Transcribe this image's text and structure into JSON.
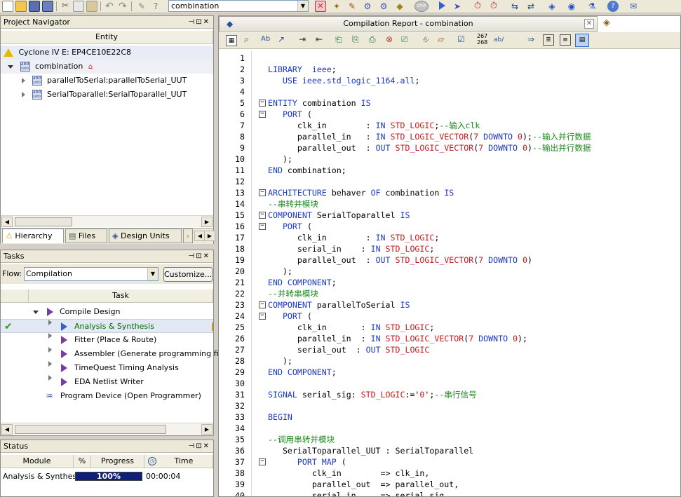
{
  "toolbar": {
    "project_combo": "combination"
  },
  "project_navigator": {
    "title": "Project Navigator",
    "entity_header": "Entity",
    "device": "Cyclone IV E: EP4CE10E22C8",
    "top": "combination",
    "children": [
      "parallelToSerial:parallelToSerial_UUT",
      "SerialToparallel:SerialToparallel_UUT"
    ],
    "tabs": [
      "Hierarchy",
      "Files",
      "Design Units"
    ]
  },
  "tasks": {
    "title": "Tasks",
    "flow_label": "Flow:",
    "flow_value": "Compilation",
    "customize": "Customize...",
    "task_header": "Task",
    "items": [
      {
        "label": "Compile Design"
      },
      {
        "label": "Analysis & Synthesis"
      },
      {
        "label": "Fitter (Place & Route)"
      },
      {
        "label": "Assembler (Generate programming files)"
      },
      {
        "label": "TimeQuest Timing Analysis"
      },
      {
        "label": "EDA Netlist Writer"
      },
      {
        "label": "Program Device (Open Programmer)"
      }
    ]
  },
  "status": {
    "title": "Status",
    "headers": {
      "module": "Module",
      "percent": "%",
      "progress": "Progress",
      "time": "Time"
    },
    "row": {
      "module": "Analysis & Synthesis",
      "progress": "100%",
      "progress_fraction": 1.0,
      "time": "00:00:04"
    }
  },
  "editor": {
    "tab_title": "Compilation Report - combination",
    "tool_numbers": "267\n268",
    "tool_ab": "ab/",
    "lines": [
      {
        "n": "1",
        "t": []
      },
      {
        "n": "2",
        "t": [
          [
            "kw",
            "LIBRARY"
          ],
          [
            "",
            "  "
          ],
          [
            "kw",
            "ieee"
          ],
          [
            "",
            ";"
          ]
        ]
      },
      {
        "n": "3",
        "t": [
          [
            "",
            "   "
          ],
          [
            "kw",
            "USE"
          ],
          [
            "",
            " "
          ],
          [
            "kw",
            "ieee.std_logic_1164.all"
          ],
          [
            "",
            ";"
          ]
        ]
      },
      {
        "n": "4",
        "t": []
      },
      {
        "n": "5",
        "f": "-",
        "t": [
          [
            "kw",
            "ENTITY"
          ],
          [
            "",
            " combination "
          ],
          [
            "kw",
            "IS"
          ]
        ]
      },
      {
        "n": "6",
        "f": "-",
        "t": [
          [
            "",
            "   "
          ],
          [
            "kw",
            "PORT"
          ],
          [
            "",
            " ("
          ]
        ]
      },
      {
        "n": "7",
        "t": [
          [
            "",
            "      clk_in        : "
          ],
          [
            "kw",
            "IN"
          ],
          [
            "",
            " "
          ],
          [
            "ty",
            "STD_LOGIC"
          ],
          [
            "",
            ";"
          ],
          [
            "cm",
            "--输入clk"
          ]
        ]
      },
      {
        "n": "8",
        "t": [
          [
            "",
            "      parallel_in   : "
          ],
          [
            "kw",
            "IN"
          ],
          [
            "",
            " "
          ],
          [
            "ty",
            "STD_LOGIC_VECTOR"
          ],
          [
            "",
            "("
          ],
          [
            "nm",
            "7"
          ],
          [
            "",
            " "
          ],
          [
            "kw",
            "DOWNTO"
          ],
          [
            "",
            " "
          ],
          [
            "nm",
            "0"
          ],
          [
            "",
            ");"
          ],
          [
            "cm",
            "--输入并行数据"
          ]
        ]
      },
      {
        "n": "9",
        "t": [
          [
            "",
            "      parallel_out  : "
          ],
          [
            "kw",
            "OUT"
          ],
          [
            "",
            " "
          ],
          [
            "ty",
            "STD_LOGIC_VECTOR"
          ],
          [
            "",
            "("
          ],
          [
            "nm",
            "7"
          ],
          [
            "",
            " "
          ],
          [
            "kw",
            "DOWNTO"
          ],
          [
            "",
            " "
          ],
          [
            "nm",
            "0"
          ],
          [
            "",
            ")"
          ],
          [
            "cm",
            "--输出并行数据"
          ]
        ]
      },
      {
        "n": "10",
        "t": [
          [
            "",
            "   );"
          ]
        ]
      },
      {
        "n": "11",
        "t": [
          [
            "kw",
            "END"
          ],
          [
            "",
            " combination;"
          ]
        ]
      },
      {
        "n": "12",
        "t": []
      },
      {
        "n": "13",
        "f": "-",
        "t": [
          [
            "kw",
            "ARCHITECTURE"
          ],
          [
            "",
            " behaver "
          ],
          [
            "kw",
            "OF"
          ],
          [
            "",
            " combination "
          ],
          [
            "kw",
            "IS"
          ]
        ]
      },
      {
        "n": "14",
        "t": [
          [
            "cm",
            "--串转并模块"
          ]
        ]
      },
      {
        "n": "15",
        "f": "-",
        "t": [
          [
            "kw",
            "COMPONENT"
          ],
          [
            "",
            " SerialToparallel "
          ],
          [
            "kw",
            "IS"
          ]
        ]
      },
      {
        "n": "16",
        "f": "-",
        "t": [
          [
            "",
            "   "
          ],
          [
            "kw",
            "PORT"
          ],
          [
            "",
            " ("
          ]
        ]
      },
      {
        "n": "17",
        "t": [
          [
            "",
            "      clk_in        : "
          ],
          [
            "kw",
            "IN"
          ],
          [
            "",
            " "
          ],
          [
            "ty",
            "STD_LOGIC"
          ],
          [
            "",
            ";"
          ]
        ]
      },
      {
        "n": "18",
        "t": [
          [
            "",
            "      serial_in    : "
          ],
          [
            "kw",
            "IN"
          ],
          [
            "",
            " "
          ],
          [
            "ty",
            "STD_LOGIC"
          ],
          [
            "",
            ";"
          ]
        ]
      },
      {
        "n": "19",
        "t": [
          [
            "",
            "      parallel_out  : "
          ],
          [
            "kw",
            "OUT"
          ],
          [
            "",
            " "
          ],
          [
            "ty",
            "STD_LOGIC_VECTOR"
          ],
          [
            "",
            "("
          ],
          [
            "nm",
            "7"
          ],
          [
            "",
            " "
          ],
          [
            "kw",
            "DOWNTO"
          ],
          [
            "",
            " "
          ],
          [
            "nm",
            "0"
          ],
          [
            "",
            ")"
          ]
        ]
      },
      {
        "n": "20",
        "t": [
          [
            "",
            "   );"
          ]
        ]
      },
      {
        "n": "21",
        "t": [
          [
            "kw",
            "END COMPONENT"
          ],
          [
            "",
            ";"
          ]
        ]
      },
      {
        "n": "22",
        "t": [
          [
            "cm",
            "--并转串模块"
          ]
        ]
      },
      {
        "n": "23",
        "f": "-",
        "t": [
          [
            "kw",
            "COMPONENT"
          ],
          [
            "",
            " parallelToSerial "
          ],
          [
            "kw",
            "IS"
          ]
        ]
      },
      {
        "n": "24",
        "f": "-",
        "t": [
          [
            "",
            "   "
          ],
          [
            "kw",
            "PORT"
          ],
          [
            "",
            " ("
          ]
        ]
      },
      {
        "n": "25",
        "t": [
          [
            "",
            "      clk_in       : "
          ],
          [
            "kw",
            "IN"
          ],
          [
            "",
            " "
          ],
          [
            "ty",
            "STD_LOGIC"
          ],
          [
            "",
            ";"
          ]
        ]
      },
      {
        "n": "26",
        "t": [
          [
            "",
            "      parallel_in  : "
          ],
          [
            "kw",
            "IN"
          ],
          [
            "",
            " "
          ],
          [
            "ty",
            "STD_LOGIC_VECTOR"
          ],
          [
            "",
            "("
          ],
          [
            "nm",
            "7"
          ],
          [
            "",
            " "
          ],
          [
            "kw",
            "DOWNTO"
          ],
          [
            "",
            " "
          ],
          [
            "nm",
            "0"
          ],
          [
            "",
            ");"
          ]
        ]
      },
      {
        "n": "27",
        "t": [
          [
            "",
            "      serial_out  : "
          ],
          [
            "kw",
            "OUT"
          ],
          [
            "",
            " "
          ],
          [
            "ty",
            "STD_LOGIC"
          ]
        ]
      },
      {
        "n": "28",
        "t": [
          [
            "",
            "   );"
          ]
        ]
      },
      {
        "n": "29",
        "t": [
          [
            "kw",
            "END COMPONENT"
          ],
          [
            "",
            ";"
          ]
        ]
      },
      {
        "n": "30",
        "t": []
      },
      {
        "n": "31",
        "t": [
          [
            "kw",
            "SIGNAL"
          ],
          [
            "",
            " serial_sig: "
          ],
          [
            "ty",
            "STD_LOGIC"
          ],
          [
            "",
            ":='"
          ],
          [
            "nm",
            "0"
          ],
          [
            "",
            "';"
          ],
          [
            "cm",
            "--串行信号"
          ]
        ]
      },
      {
        "n": "32",
        "t": []
      },
      {
        "n": "33",
        "t": [
          [
            "kw",
            "BEGIN"
          ]
        ]
      },
      {
        "n": "34",
        "t": []
      },
      {
        "n": "35",
        "t": [
          [
            "cm",
            "--调用串转并模块"
          ]
        ]
      },
      {
        "n": "36",
        "t": [
          [
            "",
            "   SerialToparallel_UUT : SerialToparallel"
          ]
        ]
      },
      {
        "n": "37",
        "f": "-",
        "t": [
          [
            "",
            "      "
          ],
          [
            "kw",
            "PORT MAP"
          ],
          [
            "",
            " ("
          ]
        ]
      },
      {
        "n": "38",
        "t": [
          [
            "",
            "         clk_in        => clk_in,"
          ]
        ]
      },
      {
        "n": "39",
        "t": [
          [
            "",
            "         parallel_out  => parallel_out,"
          ]
        ]
      },
      {
        "n": "40",
        "t": [
          [
            "",
            "         serial_in     => serial_sig"
          ]
        ]
      }
    ]
  }
}
